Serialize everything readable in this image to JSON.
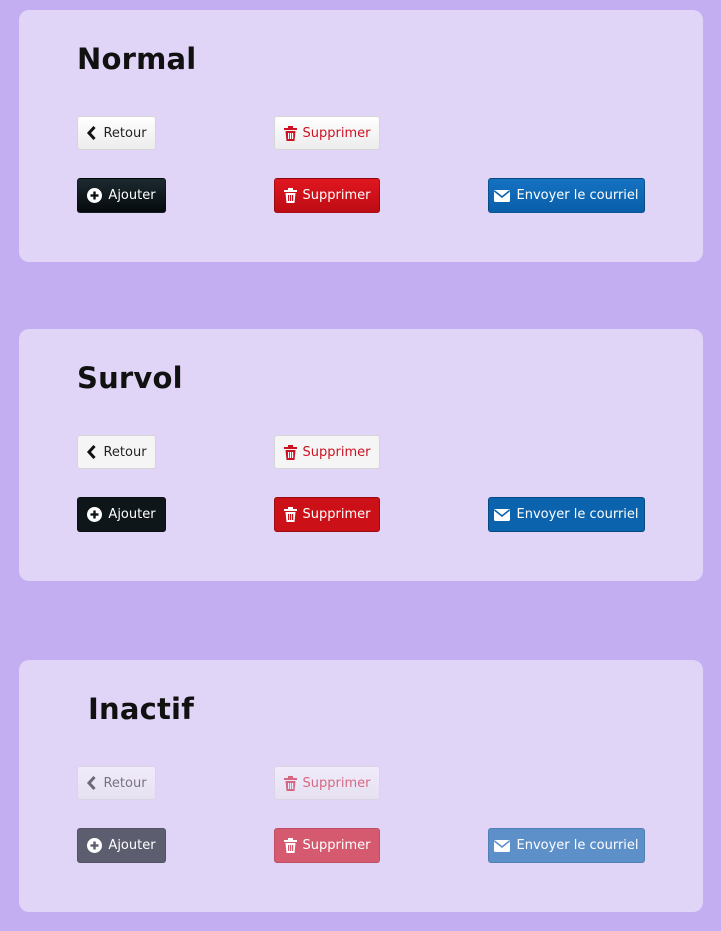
{
  "sections": [
    {
      "title": "Normal",
      "buttons": {
        "back_label": "Retour",
        "delete_light_label": "Supprimer",
        "add_label": "Ajouter",
        "delete_label": "Supprimer",
        "email_label": "Envoyer le courriel"
      }
    },
    {
      "title": "Survol",
      "buttons": {
        "back_label": "Retour",
        "delete_light_label": "Supprimer",
        "add_label": "Ajouter",
        "delete_label": "Supprimer",
        "email_label": "Envoyer le courriel"
      }
    },
    {
      "title": "Inactif",
      "buttons": {
        "back_label": "Retour",
        "delete_light_label": "Supprimer",
        "add_label": "Ajouter",
        "delete_label": "Supprimer",
        "email_label": "Envoyer le courriel"
      }
    }
  ],
  "icons": {
    "back": "chevron-left-icon",
    "delete": "trash-icon",
    "add": "plus-circle-icon",
    "email": "envelope-icon"
  },
  "colors": {
    "page_background": "#c2aef1",
    "card_background": "#e0d4f7",
    "danger": "#cc1122",
    "primary": "#0a5ea9",
    "dark": "#0b1215"
  }
}
